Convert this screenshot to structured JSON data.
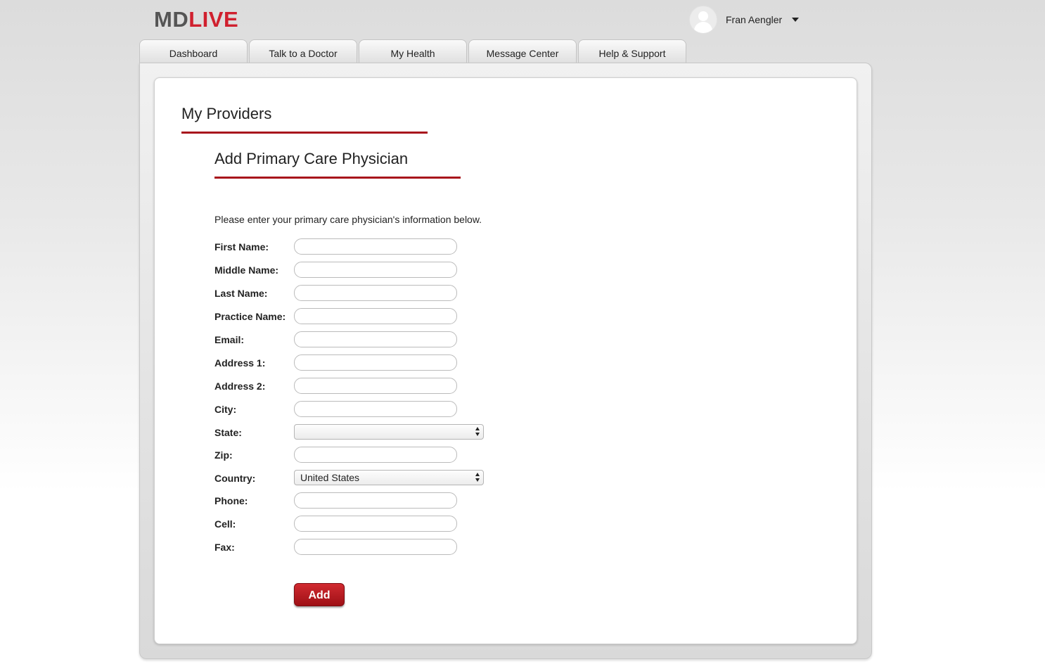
{
  "header": {
    "logo_md": "MD",
    "logo_live": "LIVE",
    "user_name": "Fran Aengler",
    "avatar_icon": "user-avatar-icon",
    "dropdown_icon": "caret-down-icon"
  },
  "nav": {
    "tabs": [
      {
        "label": "Dashboard"
      },
      {
        "label": "Talk to a Doctor"
      },
      {
        "label": "My Health"
      },
      {
        "label": "Message Center"
      },
      {
        "label": "Help & Support"
      }
    ]
  },
  "main": {
    "page_title": "My Providers",
    "section_title": "Add Primary Care Physician",
    "intro": "Please enter your primary care physician's information below.",
    "fields": {
      "first_name": {
        "label": "First Name:",
        "value": ""
      },
      "middle_name": {
        "label": "Middle Name:",
        "value": ""
      },
      "last_name": {
        "label": "Last Name:",
        "value": ""
      },
      "practice_name": {
        "label": "Practice Name:",
        "value": ""
      },
      "email": {
        "label": "Email:",
        "value": ""
      },
      "address1": {
        "label": "Address 1:",
        "value": ""
      },
      "address2": {
        "label": "Address 2:",
        "value": ""
      },
      "city": {
        "label": "City:",
        "value": ""
      },
      "state": {
        "label": "State:",
        "value": ""
      },
      "zip": {
        "label": "Zip:",
        "value": ""
      },
      "country": {
        "label": "Country:",
        "value": "United States"
      },
      "phone": {
        "label": "Phone:",
        "value": ""
      },
      "cell": {
        "label": "Cell:",
        "value": ""
      },
      "fax": {
        "label": "Fax:",
        "value": ""
      }
    },
    "add_button": "Add"
  },
  "colors": {
    "brand_red": "#d0202e",
    "rule_red": "#a8141c",
    "logo_gray": "#555555"
  }
}
